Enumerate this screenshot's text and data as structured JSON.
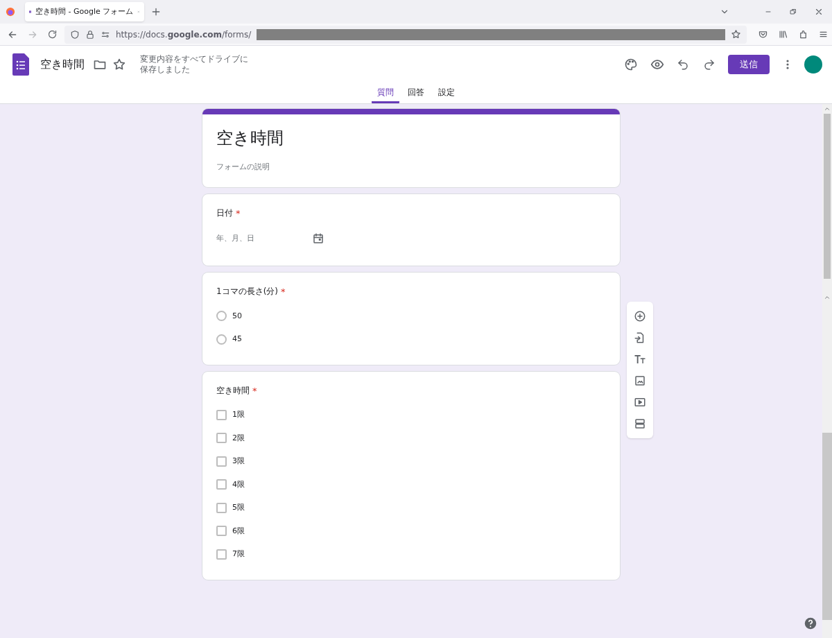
{
  "browser": {
    "tab_title": "空き時間 - Google フォーム",
    "url": "https://docs.**google.com**/forms/"
  },
  "header": {
    "title": "空き時間",
    "save_status": "変更内容をすべてドライブに保存しました",
    "send_label": "送信"
  },
  "tabs": [
    {
      "label": "質問",
      "selected": true
    },
    {
      "label": "回答",
      "selected": false
    },
    {
      "label": "設定",
      "selected": false
    }
  ],
  "form": {
    "title": "空き時間",
    "description_placeholder": "フォームの説明"
  },
  "questions": [
    {
      "kind": "date",
      "title": "日付",
      "required_mark": "*",
      "placeholder": "年、月、日"
    },
    {
      "kind": "radio",
      "title": "1コマの長さ(分)",
      "required_mark": "*",
      "options": [
        {
          "label": "50",
          "selected": false
        },
        {
          "label": "45",
          "selected": false
        }
      ]
    },
    {
      "kind": "checkbox",
      "title": "空き時間",
      "required_mark": "*",
      "options": [
        {
          "label": "1限",
          "checked": false
        },
        {
          "label": "2限",
          "checked": false
        },
        {
          "label": "3限",
          "checked": false
        },
        {
          "label": "4限",
          "checked": false
        },
        {
          "label": "5限",
          "checked": false
        },
        {
          "label": "6限",
          "checked": false
        },
        {
          "label": "7限",
          "checked": false
        }
      ]
    }
  ]
}
